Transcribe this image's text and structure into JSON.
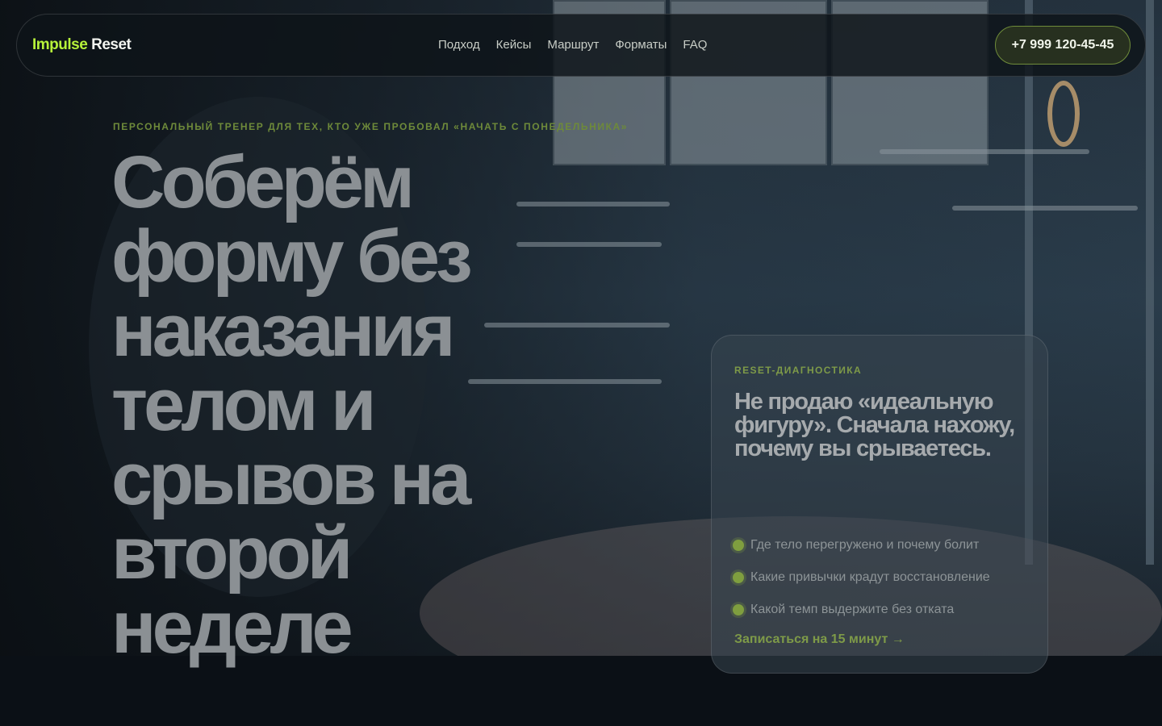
{
  "brand": {
    "part1": "Impulse",
    "part2": "Reset"
  },
  "nav": {
    "items": [
      "Подход",
      "Кейсы",
      "Маршрут",
      "Форматы",
      "FAQ"
    ]
  },
  "header": {
    "phone": "+7 999 120-45-45"
  },
  "hero": {
    "eyebrow": "ПЕРСОНАЛЬНЫЙ ТРЕНЕР ДЛЯ ТЕХ, КТО УЖЕ ПРОБОВАЛ «НАЧАТЬ С ПОНЕДЕЛЬНИКА»",
    "headline_lines": [
      "Соберём",
      "форму без",
      "наказания",
      "телом и",
      "срывов на",
      "второй",
      "неделе"
    ]
  },
  "card": {
    "kicker": "RESET-ДИАГНОСТИКА",
    "title": "Не продаю «идеальную фигуру». Сначала нахожу, почему вы срываетесь.",
    "items": [
      "Где тело перегружено и почему болит",
      "Какие привычки крадут восстановление",
      "Какой темп выдержите без отката"
    ],
    "cta": "Записаться на 15 минут →"
  },
  "colors": {
    "accent": "#b6f23a",
    "background": "#0b1016"
  }
}
